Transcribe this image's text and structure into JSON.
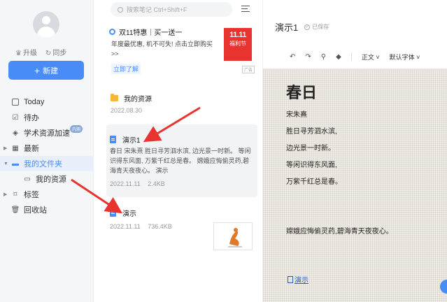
{
  "sidebar": {
    "upgrade_label": "升级",
    "sync_label": "同步",
    "new_label": "新建",
    "nav": {
      "today": "Today",
      "todo": "待办",
      "academic": "学术资源加速",
      "academic_badge": "内测",
      "recent": "最新",
      "my_folder": "我的文件夹",
      "my_resources": "我的资源",
      "tags": "标签",
      "trash": "回收站"
    }
  },
  "list": {
    "search_placeholder": "搜索笔记 Ctrl+Shift+F",
    "ad": {
      "title": "双11特惠｜买一送一",
      "desc": "年度最优惠, 机不可失! 点击立即购买>>",
      "link": "立即了解",
      "banner_line1": "11.11",
      "banner_line2": "福利节",
      "tag": "广告"
    },
    "notes": [
      {
        "title": "我的资源",
        "date": "2022.08.30"
      },
      {
        "title": "演示1",
        "excerpt": "春日 宋朱熹 胜日寻芳泗水滨, 边光景一时新。 等闲识得东风面, 万紫千红总是春。 嫦娥应悔偷灵药,碧海青天夜夜心。 演示",
        "date": "2022.11.11",
        "size": "2.4KB"
      },
      {
        "title": "演示",
        "date": "2022.11.11",
        "size": "736.4KB"
      }
    ]
  },
  "editor": {
    "title": "演示1",
    "saved": "已保存",
    "toolbar": {
      "style": "正文",
      "font": "默认字体"
    },
    "poem": {
      "title": "春日",
      "lines": [
        "宋朱熹",
        "胜日寻芳泗水滨,",
        "边光景一时新。",
        "等闲识得东风面,",
        "万紫千红总是春。"
      ],
      "extra": "嫦娥应悔偷灵药,碧海青天夜夜心。",
      "attachment": "演示"
    }
  },
  "colors": {
    "accent": "#4a8cf7",
    "arrow": "#e8332f",
    "banner": "#e8332f"
  }
}
